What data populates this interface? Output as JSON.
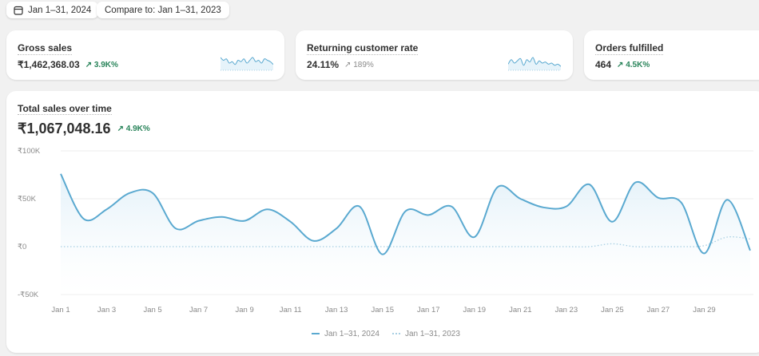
{
  "toolbar": {
    "date_range": "Jan 1–31, 2024",
    "compare": "Compare to: Jan 1–31, 2023",
    "calendar_icon": "calendar-icon"
  },
  "kpis": [
    {
      "title": "Gross sales",
      "value": "₹1,462,368.03",
      "delta": "3.9K%",
      "delta_tone": "positive",
      "spark": [
        8,
        6,
        7,
        4,
        5,
        3,
        6,
        5,
        7,
        4,
        6,
        8,
        5,
        6,
        4,
        7,
        6,
        5,
        3
      ]
    },
    {
      "title": "Returning customer rate",
      "value": "24.11%",
      "delta": "189%",
      "delta_tone": "neutral",
      "spark": [
        4,
        8,
        5,
        7,
        9,
        3,
        8,
        6,
        10,
        4,
        7,
        5,
        6,
        4,
        5,
        3,
        4,
        2
      ]
    },
    {
      "title": "Orders fulfilled",
      "value": "464",
      "delta": "4.5K%",
      "delta_tone": "positive"
    }
  ],
  "colors": {
    "series_2024": "#5aa9d0",
    "series_2023": "#a8cfe3",
    "positive": "#29845a",
    "background": "#f1f1f1"
  },
  "chart": {
    "title": "Total sales over time",
    "value": "₹1,067,048.16",
    "delta": "4.9K%"
  },
  "chart_data": {
    "type": "line",
    "x": [
      "Jan 1",
      "Jan 2",
      "Jan 3",
      "Jan 4",
      "Jan 5",
      "Jan 6",
      "Jan 7",
      "Jan 8",
      "Jan 9",
      "Jan 10",
      "Jan 11",
      "Jan 12",
      "Jan 13",
      "Jan 14",
      "Jan 15",
      "Jan 16",
      "Jan 17",
      "Jan 18",
      "Jan 19",
      "Jan 20",
      "Jan 21",
      "Jan 22",
      "Jan 23",
      "Jan 24",
      "Jan 25",
      "Jan 26",
      "Jan 27",
      "Jan 28",
      "Jan 29",
      "Jan 30",
      "Jan 31"
    ],
    "xtick_labels": [
      "Jan 1",
      "Jan 3",
      "Jan 5",
      "Jan 7",
      "Jan 9",
      "Jan 11",
      "Jan 13",
      "Jan 15",
      "Jan 17",
      "Jan 19",
      "Jan 21",
      "Jan 23",
      "Jan 25",
      "Jan 27",
      "Jan 29"
    ],
    "ytick_labels": [
      "₹100K",
      "₹50K",
      "₹0",
      "-₹50K"
    ],
    "yticks": [
      100000,
      50000,
      0,
      -50000
    ],
    "ylim": [
      -50000,
      100000
    ],
    "grid": true,
    "legend_position": "bottom-center",
    "series": [
      {
        "name": "Jan 1–31, 2024",
        "style": "solid",
        "values": [
          76000,
          29000,
          39000,
          56000,
          56000,
          19000,
          27000,
          31000,
          27000,
          39000,
          26000,
          6000,
          19000,
          42000,
          -8000,
          37000,
          33000,
          42000,
          10000,
          62000,
          50000,
          41000,
          42000,
          65000,
          26000,
          67000,
          51000,
          46000,
          -7000,
          49000,
          -4000
        ]
      },
      {
        "name": "Jan 1–31, 2023",
        "style": "dotted",
        "values": [
          0,
          0,
          0,
          0,
          0,
          0,
          0,
          0,
          0,
          0,
          0,
          0,
          0,
          0,
          0,
          0,
          0,
          0,
          0,
          0,
          0,
          0,
          0,
          0,
          3000,
          0,
          0,
          0,
          1000,
          10000,
          8000
        ]
      }
    ]
  }
}
